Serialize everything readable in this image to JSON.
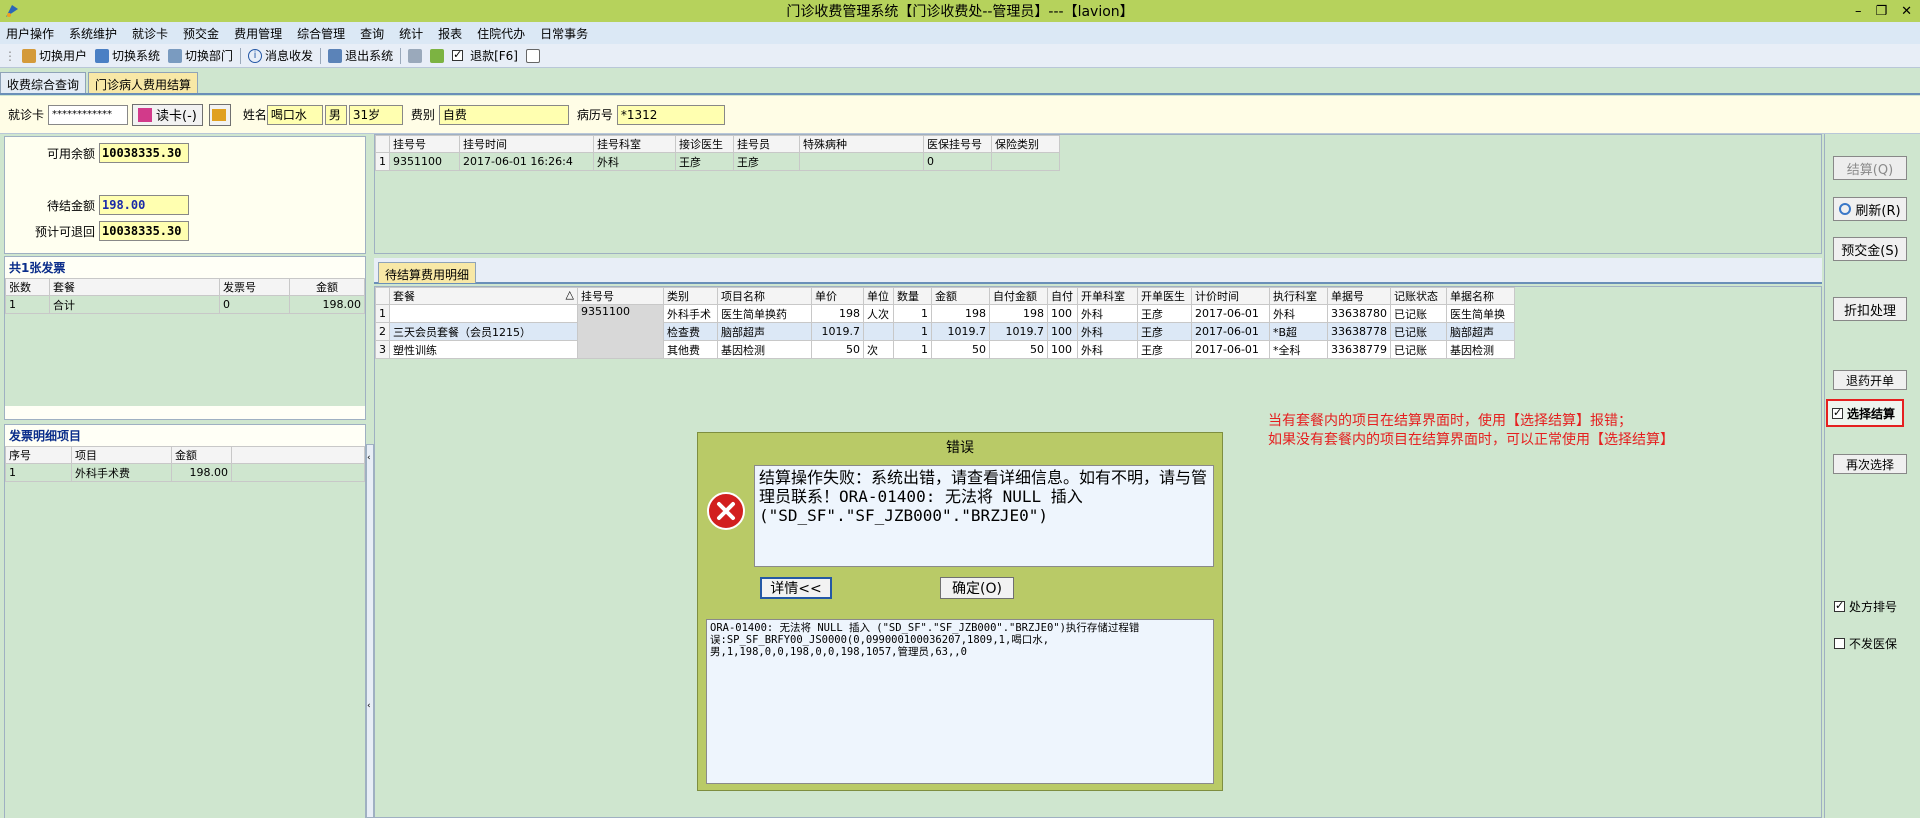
{
  "window": {
    "title": "门诊收费管理系统【门诊收费处--管理员】---【lavion】",
    "min": "–",
    "restore": "❐",
    "close": "✕"
  },
  "menu": [
    "用户操作",
    "系统维护",
    "就诊卡",
    "预交金",
    "费用管理",
    "综合管理",
    "查询",
    "统计",
    "报表",
    "住院代办",
    "日常事务"
  ],
  "toolbar": {
    "switch_user": "切换用户",
    "switch_system": "切换系统",
    "switch_dept": "切换部门",
    "messages": "消息收发",
    "exit": "退出系统",
    "refund": "退款[F6]"
  },
  "tabs": [
    "收费综合查询",
    "门诊病人费用结算"
  ],
  "card": {
    "card_label": "就诊卡",
    "card_value": "************",
    "read_card": "读卡(-)",
    "name_label": "姓名",
    "name": "喝口水",
    "sex": "男",
    "age": "31岁",
    "fee_label": "费别",
    "fee_type": "自费",
    "record_label": "病历号",
    "record_no": "*1312"
  },
  "balance": {
    "available_label": "可用余额",
    "available": "10038335.30",
    "pending_label": "待结金额",
    "pending": "198.00",
    "refundable_label": "预计可退回",
    "refundable": "10038335.30"
  },
  "invoices": {
    "header": "共1张发票",
    "columns": [
      "张数",
      "套餐",
      "发票号",
      "金额"
    ],
    "rows": [
      [
        "1",
        "合计",
        "0",
        "198.00"
      ]
    ]
  },
  "invoice_items": {
    "header": "发票明细项目",
    "columns": [
      "序号",
      "项目",
      "金额"
    ],
    "rows": [
      [
        "1",
        "外科手术费",
        "198.00"
      ]
    ]
  },
  "registration": {
    "columns": [
      "",
      "挂号号",
      "挂号时间",
      "挂号科室",
      "接诊医生",
      "挂号员",
      "特殊病种",
      "医保挂号号",
      "保险类别"
    ],
    "rows": [
      [
        "1",
        "9351100",
        "2017-06-01 16:26:4",
        "外科",
        "王彦",
        "王彦",
        "",
        "0",
        ""
      ]
    ]
  },
  "pending_tab": "待结算费用明细",
  "fees": {
    "sort_arrow": "△",
    "columns": [
      "",
      "套餐",
      "挂号号",
      "类别",
      "项目名称",
      "单价",
      "单位",
      "数量",
      "金额",
      "自付金额",
      "自付",
      "开单科室",
      "开单医生",
      "计价时间",
      "执行科室",
      "单据号",
      "记账状态",
      "单据名称"
    ],
    "rows": [
      [
        "1",
        "",
        "9351100",
        "外科手术",
        "医生简单换药",
        "198",
        "人次",
        "1",
        "198",
        "198",
        "100",
        "外科",
        "王彦",
        "2017-06-01",
        "外科",
        "33638780",
        "已记账",
        "医生简单换"
      ],
      [
        "2",
        "三天会员套餐（会员1215）",
        "",
        "检查费",
        "脑部超声",
        "1019.7",
        "",
        "1",
        "1019.7",
        "1019.7",
        "100",
        "外科",
        "王彦",
        "2017-06-01",
        "*B超",
        "33638778",
        "已记账",
        "脑部超声"
      ],
      [
        "3",
        "塑性训练",
        "",
        "其他费",
        "基因检测",
        "50",
        "次",
        "1",
        "50",
        "50",
        "100",
        "外科",
        "王彦",
        "2017-06-01",
        "*全科",
        "33638779",
        "已记账",
        "基因检测"
      ]
    ]
  },
  "actions": {
    "settle": "结算(Q)",
    "refresh": "刷新(R)",
    "prepay": "预交金(S)",
    "discount": "折扣处理",
    "refund_drug": "退药开单",
    "select_settle": "选择结算",
    "reselect": "再次选择",
    "rx_sort": "处方排号",
    "no_insurance": "不发医保"
  },
  "annotation": {
    "line1": "当有套餐内的项目在结算界面时，使用【选择结算】报错；",
    "line2": "如果没有套餐内的项目在结算界面时，可以正常使用【选择结算】"
  },
  "dialog": {
    "title": "错误",
    "message": "结算操作失败：系统出错，请查看详细信息。如有不明，请与管理员联系！ORA-01400: 无法将 NULL 插入 (\"SD_SF\".\"SF_JZB000\".\"BRZJE0\")",
    "details_button": "详情<<",
    "ok_button": "确定(O)",
    "detail": "ORA-01400: 无法将 NULL 插入 (\"SD_SF\".\"SF_JZB000\".\"BRZJE0\")执行存储过程错误:SP_SF_BRFY00_JS0000(0,099000100036207,1809,1,喝口水,男,1,198,0,0,198,0,0,198,1057,管理员,63,,0"
  },
  "colors": {
    "title_bar": "#b6d25c",
    "dialog": "#b9ca67",
    "annotation": "#e52020",
    "highlight_border": "#e52020"
  }
}
